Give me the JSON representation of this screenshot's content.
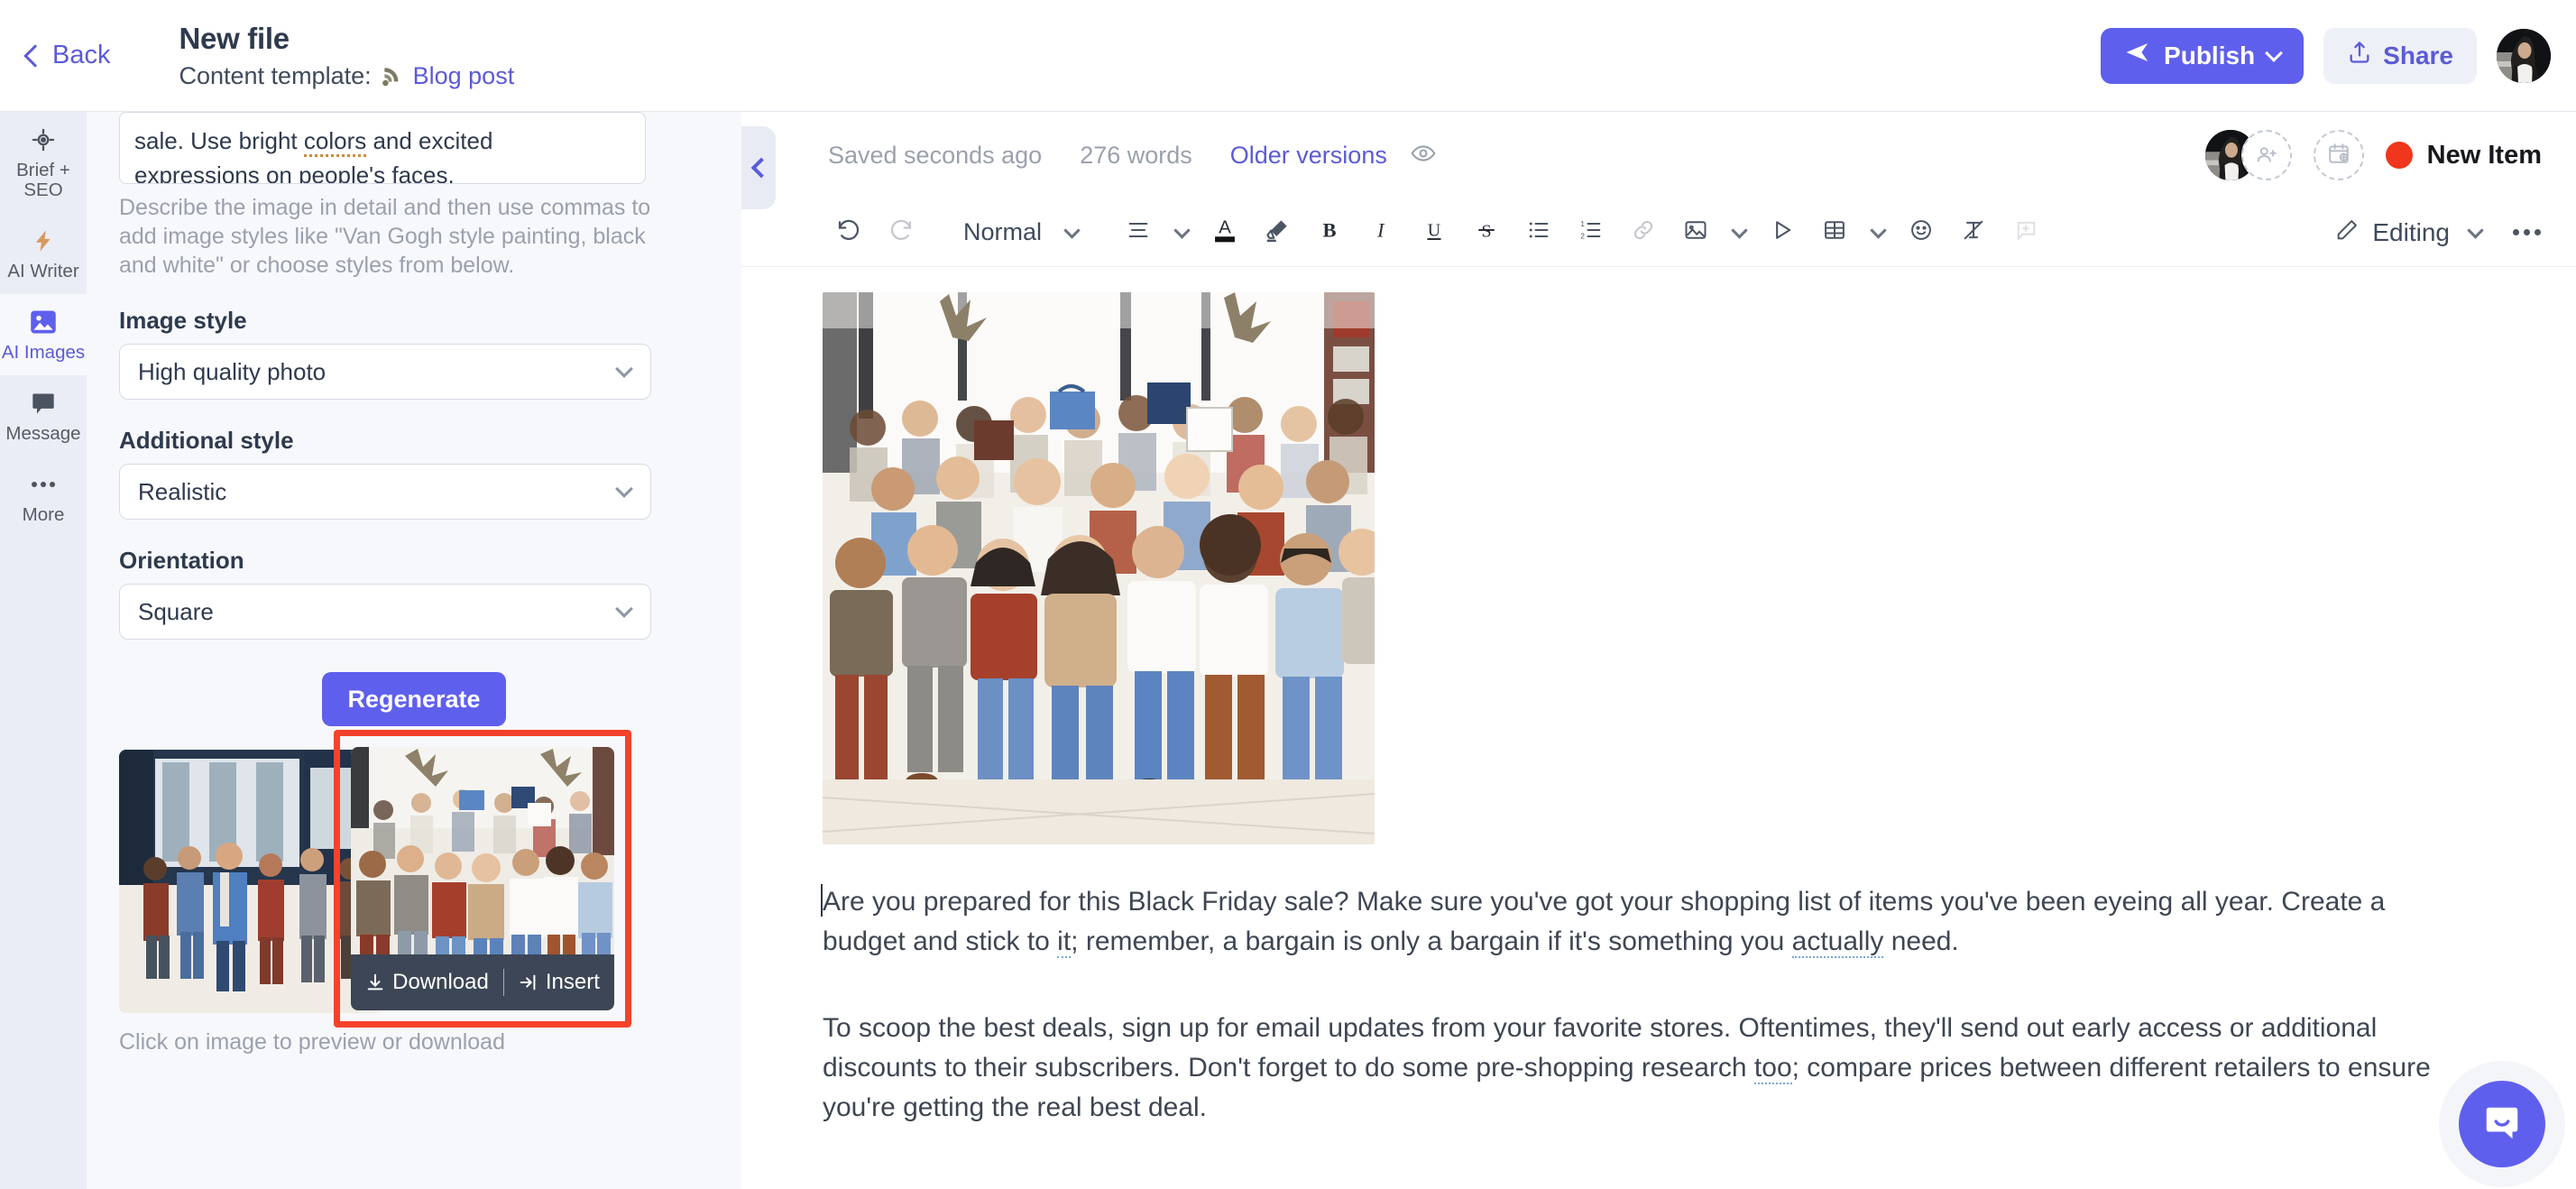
{
  "header": {
    "back_label": "Back",
    "file_title": "New file",
    "template_label": "Content template:",
    "template_link": "Blog post",
    "template_icon": "rss-icon",
    "publish_label": "Publish",
    "publish_icon": "send-icon",
    "publish_caret_icon": "chevron-down-icon",
    "share_label": "Share",
    "share_icon": "upload-icon",
    "avatar_name": "user-avatar"
  },
  "colors": {
    "accent": "#5f5fed",
    "link": "#5b5bd6",
    "highlight_border": "#f5422a",
    "status_dot": "#f0361c",
    "panel_bg": "#f7f8fb",
    "rail_bg": "#eaedf6"
  },
  "rail": {
    "items": [
      {
        "label": "Brief + SEO",
        "icon": "target-icon",
        "active": false
      },
      {
        "label": "AI Writer",
        "icon": "lightning-icon",
        "active": false
      },
      {
        "label": "AI Images",
        "icon": "image-icon",
        "active": true
      },
      {
        "label": "Message",
        "icon": "chat-icon",
        "active": false
      },
      {
        "label": "More",
        "icon": "ellipsis-icon",
        "active": false
      }
    ]
  },
  "panel": {
    "prompt_value_line1": "sale. Use bright ",
    "prompt_spell_word": "colors",
    "prompt_value_line1b": " and excited",
    "prompt_value_line2": "expressions on people's faces.",
    "helper_text": "Describe the image in detail and then use commas to add image styles like \"Van Gogh style painting, black and white\" or choose styles from below.",
    "fields": [
      {
        "label": "Image style",
        "value": "High quality photo",
        "icon": "chevron-down-icon"
      },
      {
        "label": "Additional style",
        "value": "Realistic",
        "icon": "chevron-down-icon"
      },
      {
        "label": "Orientation",
        "value": "Square",
        "icon": "chevron-down-icon"
      }
    ],
    "regenerate_label": "Regenerate",
    "thumb_overlay": {
      "download_label": "Download",
      "download_icon": "download-icon",
      "insert_label": "Insert",
      "insert_icon": "insert-arrow-icon"
    },
    "thumbs_caption": "Click on image to preview or download",
    "collapse_icon": "chevron-left-icon"
  },
  "editor": {
    "status": {
      "saved_text": "Saved seconds ago",
      "word_count": "276 words",
      "versions_link": "Older versions",
      "preview_icon": "eye-icon",
      "add_collaborator_icon": "add-user-icon",
      "schedule_icon": "calendar-plus-icon",
      "new_item_label": "New Item"
    },
    "toolbar": {
      "undo_icon": "undo-icon",
      "redo_icon": "redo-icon",
      "paragraph_style": "Normal",
      "paragraph_caret_icon": "chevron-down-icon",
      "align_icon": "align-left-icon",
      "align_caret_icon": "chevron-down-icon",
      "text_color_icon": "text-color-icon",
      "highlight_icon": "highlighter-icon",
      "bold_icon": "bold-icon",
      "italic_icon": "italic-icon",
      "underline_icon": "underline-icon",
      "strike_icon": "strikethrough-icon",
      "bullet_list_icon": "bullet-list-icon",
      "numbered_list_icon": "numbered-list-icon",
      "link_icon": "link-icon",
      "image_icon": "image-insert-icon",
      "image_caret_icon": "chevron-down-icon",
      "video_icon": "play-icon",
      "table_icon": "table-icon",
      "table_caret_icon": "chevron-down-icon",
      "emoji_icon": "emoji-icon",
      "clear_format_icon": "clear-formatting-icon",
      "comment_icon": "add-comment-icon",
      "mode_icon": "pencil-icon",
      "mode_label": "Editing",
      "mode_caret_icon": "chevron-down-icon",
      "more_icon": "ellipsis-icon"
    },
    "document": {
      "hero_image_alt": "crowd-of-shoppers-running",
      "paragraph_1_a": "Are you prepared for this Black Friday sale? Make sure you've got your shopping list of items you've been eyeing all year. Create a budget and stick to ",
      "paragraph_1_spell1": "it",
      "paragraph_1_b": "; remember, a bargain is only a bargain if it's something you ",
      "paragraph_1_spell2": "actually",
      "paragraph_1_c": " need.",
      "paragraph_2_a": "To scoop the best deals, sign up for email updates from your favorite stores. Oftentimes, they'll send out early access or additional discounts to their subscribers. Don't forget to do some pre-shopping research ",
      "paragraph_2_spell1": "too",
      "paragraph_2_b": "; compare prices between different retailers to ensure you're getting the real best deal."
    },
    "intercom_icon": "chat-bubble-icon"
  }
}
